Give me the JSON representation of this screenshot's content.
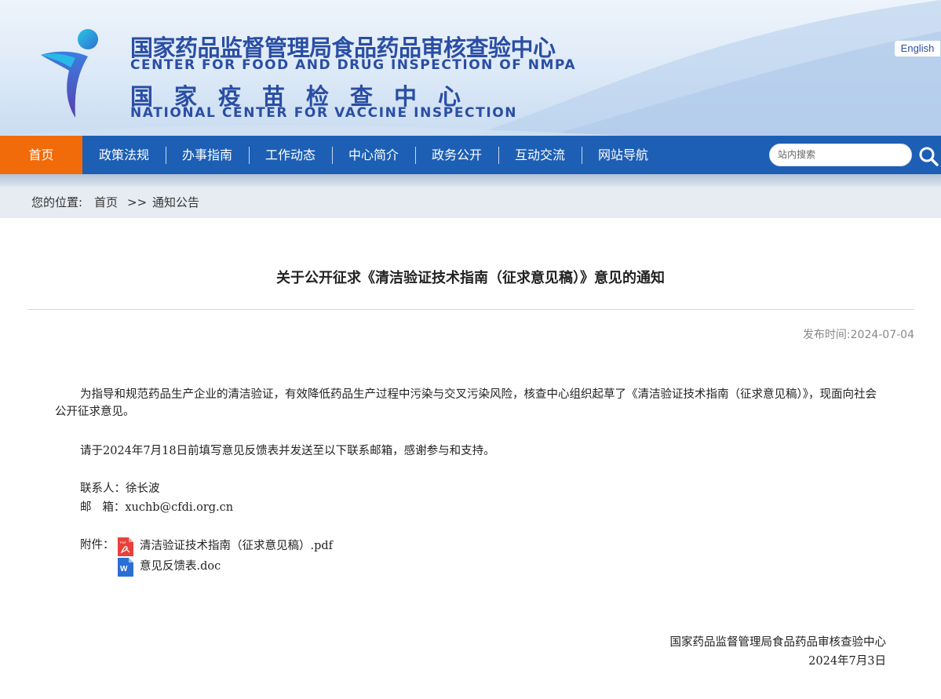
{
  "header": {
    "title_cn": "国家药品监督管理局食品药品审核查验中心",
    "title_en": "CENTER FOR FOOD AND DRUG INSPECTION OF NMPA",
    "title_cn2": "国家疫苗检查中心",
    "title_en2": "NATIONAL CENTER FOR VACCINE INSPECTION",
    "language_button": "English"
  },
  "nav": {
    "items": [
      {
        "label": "首页"
      },
      {
        "label": "政策法规"
      },
      {
        "label": "办事指南"
      },
      {
        "label": "工作动态"
      },
      {
        "label": "中心简介"
      },
      {
        "label": "政务公开"
      },
      {
        "label": "互动交流"
      },
      {
        "label": "网站导航"
      }
    ],
    "active_color": "#f26b0a",
    "bar_color": "#1d5fb4",
    "search_placeholder": "站内搜索"
  },
  "breadcrumb": {
    "prefix": "您的位置:",
    "home": "首页",
    "separator": ">>",
    "current": "通知公告"
  },
  "article": {
    "title": "关于公开征求《清洁验证技术指南（征求意见稿）》意见的通知",
    "publish_label": "发布时间:",
    "publish_date": "2024-07-04",
    "para1": "为指导和规范药品生产企业的清洁验证，有效降低药品生产过程中污染与交叉污染风险，核查中心组织起草了《清洁验证技术指南（征求意见稿）》，现面向社会公开征求意见。",
    "para2": "请于2024年7月18日前填写意见反馈表并发送至以下联系邮箱，感谢参与和支持。",
    "contact_line": "联系人：徐长波",
    "email_line": "邮   箱：xuchb@cfdi.org.cn",
    "attachments_label": "附件：",
    "attachments": [
      {
        "name": "清洁验证技术指南（征求意见稿）.pdf",
        "icon": "pdf-file-icon"
      },
      {
        "name": "意见反馈表.doc",
        "icon": "word-file-icon"
      }
    ],
    "signature_org": "国家药品监督管理局食品药品审核查验中心",
    "signature_date": "2024年7月3日"
  }
}
